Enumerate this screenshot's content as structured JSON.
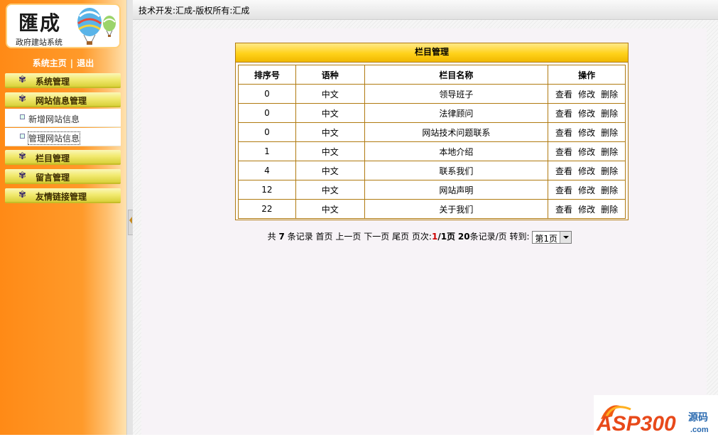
{
  "logo": {
    "title": "匯成",
    "subtitle": "政府建站系统"
  },
  "top_nav": {
    "home": "系统主页",
    "separator": "|",
    "logout": "退出"
  },
  "sidebar": {
    "menus": [
      {
        "label": "系统管理"
      },
      {
        "label": "网站信息管理"
      },
      {
        "label": "栏目管理"
      },
      {
        "label": "留言管理"
      },
      {
        "label": "友情链接管理"
      }
    ],
    "submenu": [
      {
        "label": "新增网站信息"
      },
      {
        "label": "管理网站信息"
      }
    ]
  },
  "header": {
    "text": "技术开发:汇成-版权所有:汇成"
  },
  "table": {
    "caption": "栏目管理",
    "columns": [
      "排序号",
      "语种",
      "栏目名称",
      "操作"
    ],
    "actions": [
      "查看",
      "修改",
      "删除"
    ],
    "rows": [
      {
        "order": "0",
        "lang": "中文",
        "name": "领导班子"
      },
      {
        "order": "0",
        "lang": "中文",
        "name": "法律顾问"
      },
      {
        "order": "0",
        "lang": "中文",
        "name": "网站技术问题联系"
      },
      {
        "order": "1",
        "lang": "中文",
        "name": "本地介绍"
      },
      {
        "order": "4",
        "lang": "中文",
        "name": "联系我们"
      },
      {
        "order": "12",
        "lang": "中文",
        "name": "网站声明"
      },
      {
        "order": "22",
        "lang": "中文",
        "name": "关于我们"
      }
    ]
  },
  "pager": {
    "total_prefix": "共",
    "total": "7",
    "total_suffix": "条记录",
    "first": "首页",
    "prev": "上一页",
    "next": "下一页",
    "last": "尾页",
    "page_label": "页次:",
    "current_page": "1",
    "page_total": "/1页",
    "per_page": "20",
    "per_page_suffix": "条记录/页",
    "goto_label": "转到:",
    "select_value": "第1页"
  },
  "watermark": {
    "brand": "ASP300",
    "suffix": "源码",
    "domain": ".com"
  }
}
